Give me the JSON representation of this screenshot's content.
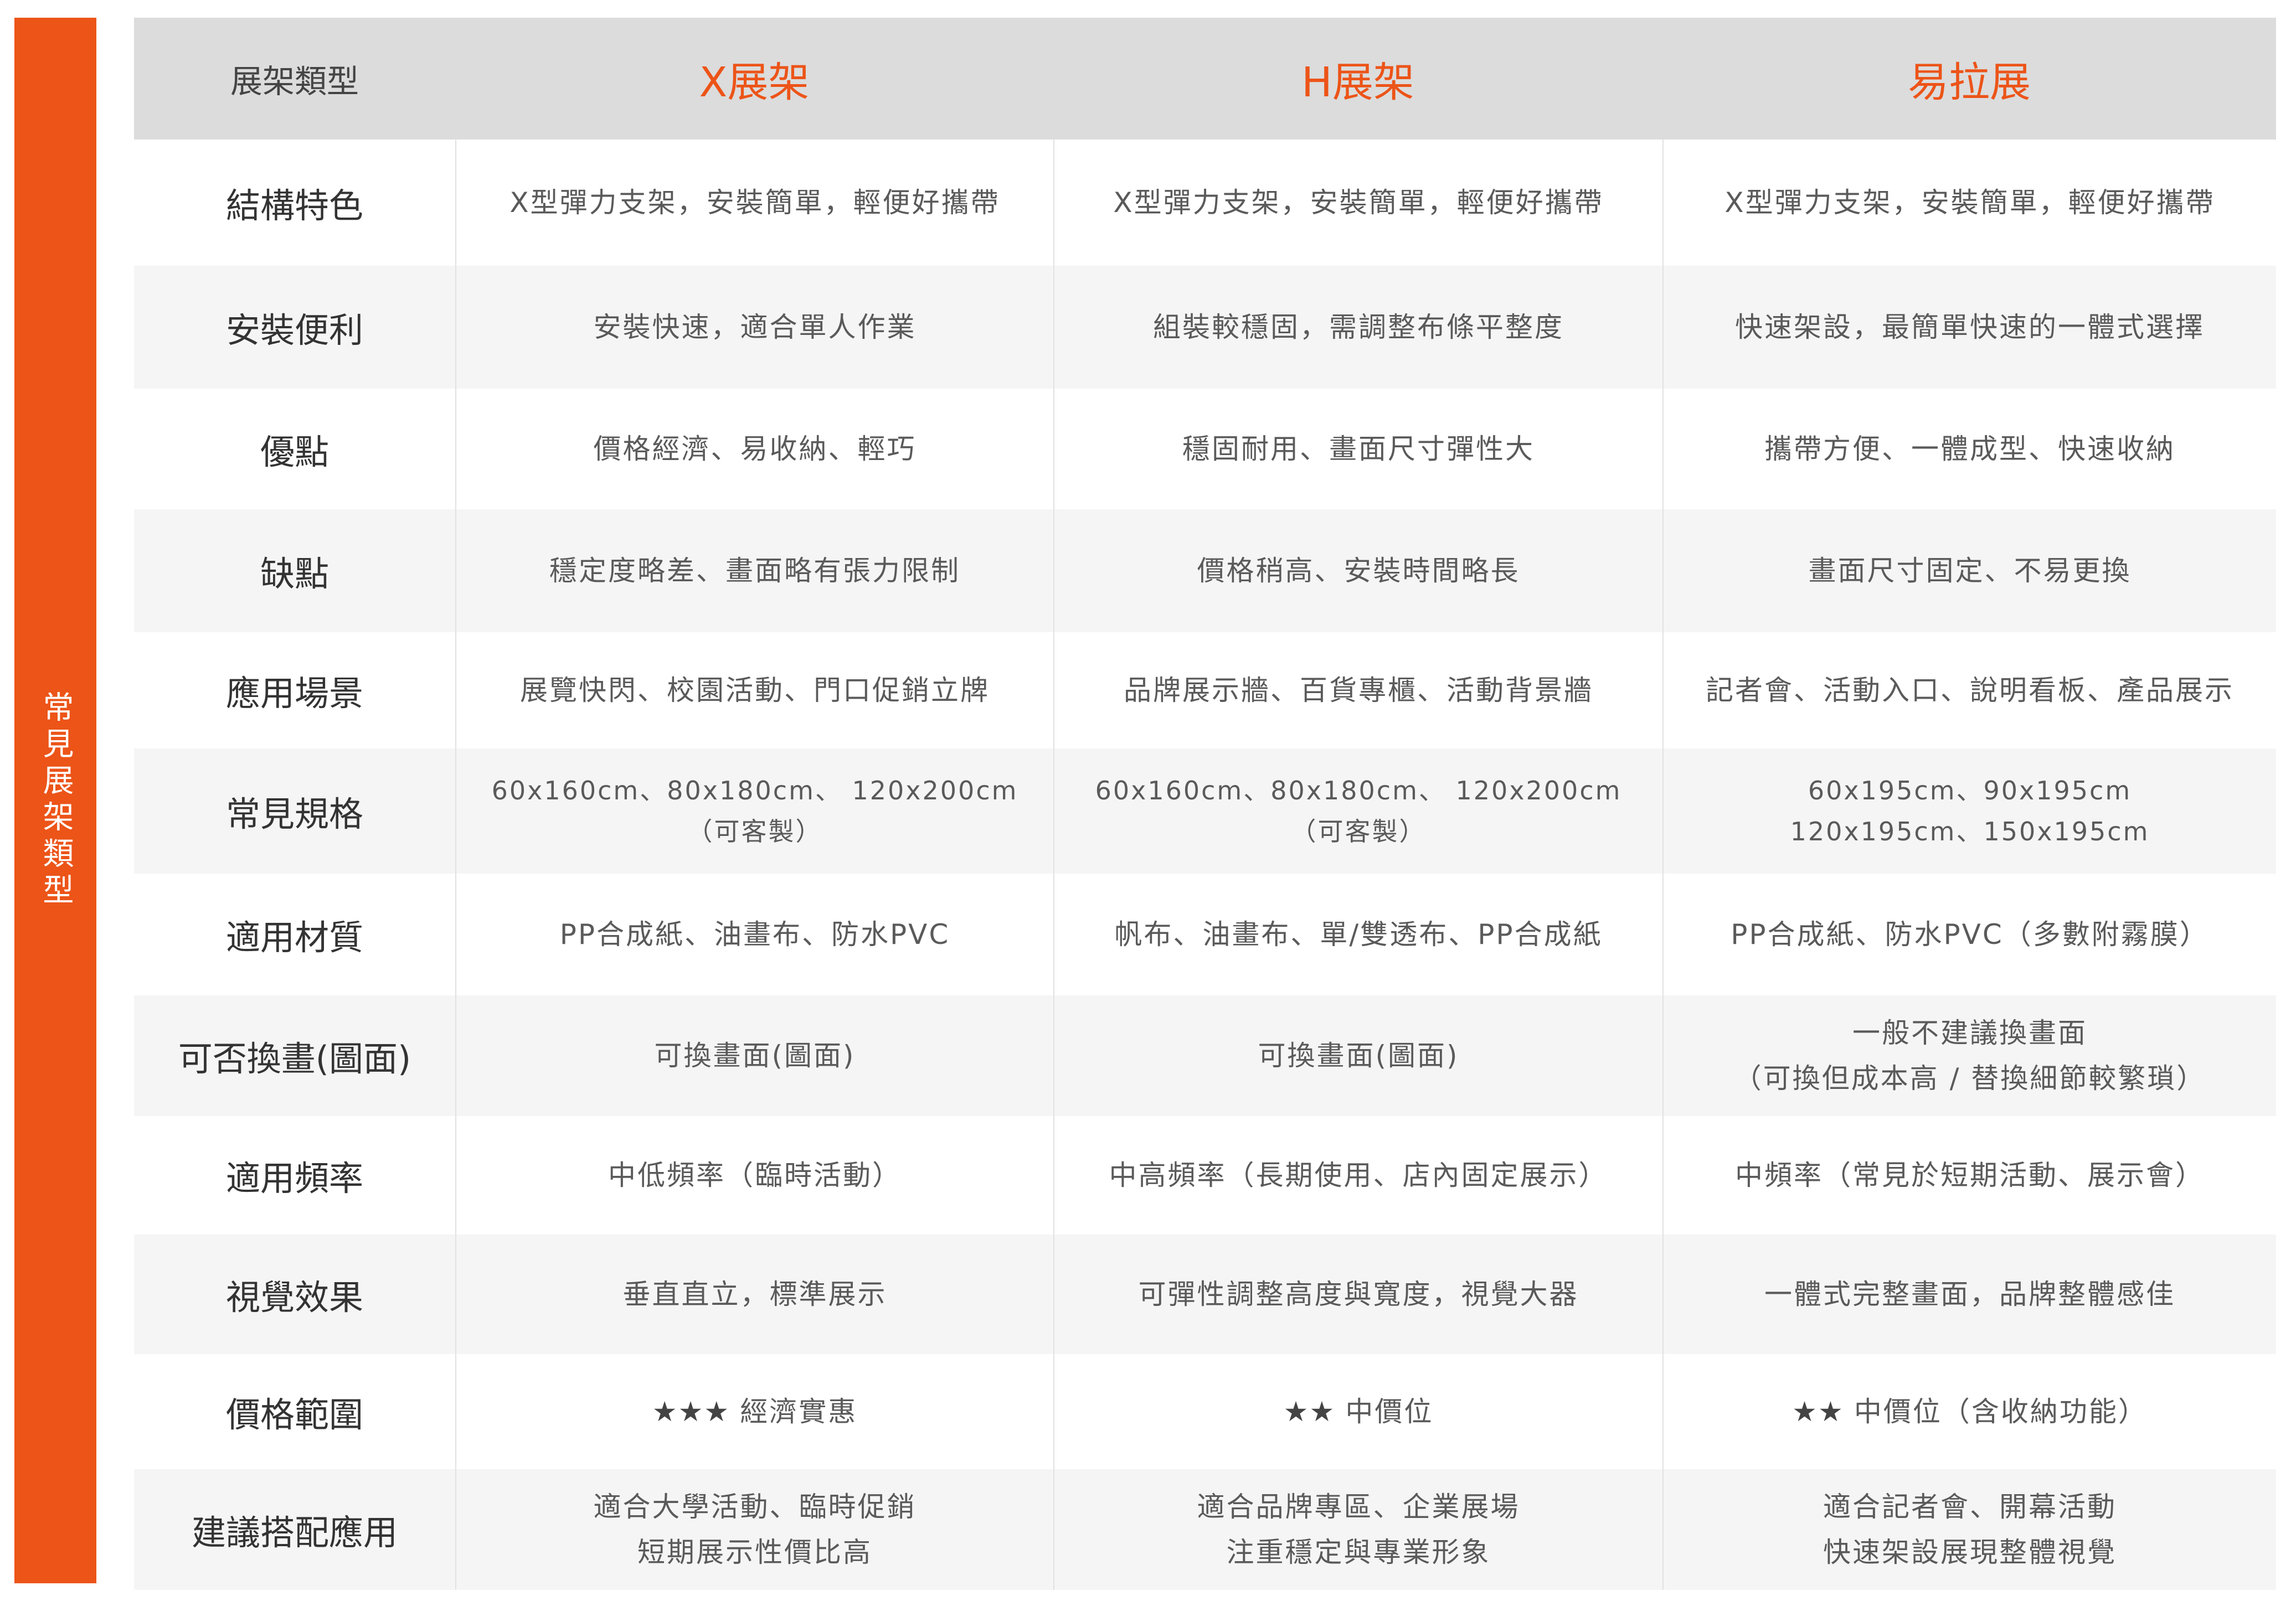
{
  "side_label": "常見展架類型",
  "colors": {
    "accent": "#ec5418",
    "header_bg": "#dcdcdc",
    "row_shade": "#f4f5f4"
  },
  "header": {
    "label": "展架類型",
    "columns": [
      "X展架",
      "H展架",
      "易拉展"
    ]
  },
  "rows": [
    {
      "label": "結構特色",
      "cells": [
        [
          "X型彈力支架，安裝簡單，輕便好攜帶"
        ],
        [
          "X型彈力支架，安裝簡單，輕便好攜帶"
        ],
        [
          "X型彈力支架，安裝簡單，輕便好攜帶"
        ]
      ]
    },
    {
      "label": "安裝便利",
      "cells": [
        [
          "安裝快速，適合單人作業"
        ],
        [
          "組裝較穩固，需調整布條平整度"
        ],
        [
          "快速架設，最簡單快速的一體式選擇"
        ]
      ]
    },
    {
      "label": "優點",
      "cells": [
        [
          "價格經濟、易收納、輕巧"
        ],
        [
          "穩固耐用、畫面尺寸彈性大"
        ],
        [
          "攜帶方便、一體成型、快速收納"
        ]
      ]
    },
    {
      "label": "缺點",
      "cells": [
        [
          "穩定度略差、畫面略有張力限制"
        ],
        [
          "價格稍高、安裝時間略長"
        ],
        [
          "畫面尺寸固定、不易更換"
        ]
      ]
    },
    {
      "label": "應用場景",
      "cells": [
        [
          "展覽快閃、校園活動、門口促銷立牌"
        ],
        [
          "品牌展示牆、百貨專櫃、活動背景牆"
        ],
        [
          "記者會、活動入口、說明看板、產品展示"
        ]
      ]
    },
    {
      "label": "常見規格",
      "cells": [
        [
          "60x160cm、80x180cm、 120x200cm",
          "（可客製）"
        ],
        [
          "60x160cm、80x180cm、 120x200cm",
          "（可客製）"
        ],
        [
          "60x195cm、90x195cm",
          "120x195cm、150x195cm"
        ]
      ]
    },
    {
      "label": "適用材質",
      "cells": [
        [
          "PP合成紙、油畫布、防水PVC"
        ],
        [
          "帆布、油畫布、單/雙透布、PP合成紙"
        ],
        [
          "PP合成紙、防水PVC（多數附霧膜）"
        ]
      ]
    },
    {
      "label": "可否換畫(圖面)",
      "cells": [
        [
          "可換畫面(圖面)"
        ],
        [
          "可換畫面(圖面)"
        ],
        [
          "一般不建議換畫面",
          "（可換但成本高 / 替換細節較繁瑣）"
        ]
      ]
    },
    {
      "label": "適用頻率",
      "cells": [
        [
          "中低頻率（臨時活動）"
        ],
        [
          "中高頻率（長期使用、店內固定展示）"
        ],
        [
          "中頻率（常見於短期活動、展示會）"
        ]
      ]
    },
    {
      "label": "視覺效果",
      "cells": [
        [
          "垂直直立，標準展示"
        ],
        [
          "可彈性調整高度與寬度，視覺大器"
        ],
        [
          "一體式完整畫面，品牌整體感佳"
        ]
      ]
    },
    {
      "label": "價格範圍",
      "price": [
        {
          "stars": "★★★",
          "text": "經濟實惠"
        },
        {
          "stars": "★★",
          "text": "中價位"
        },
        {
          "stars": "★★",
          "text": "中價位（含收納功能）"
        }
      ]
    },
    {
      "label": "建議搭配應用",
      "cells": [
        [
          "適合大學活動、臨時促銷",
          "短期展示性價比高"
        ],
        [
          "適合品牌專區、企業展場",
          "注重穩定與專業形象"
        ],
        [
          "適合記者會、開幕活動",
          "快速架設展現整體視覺"
        ]
      ]
    }
  ]
}
